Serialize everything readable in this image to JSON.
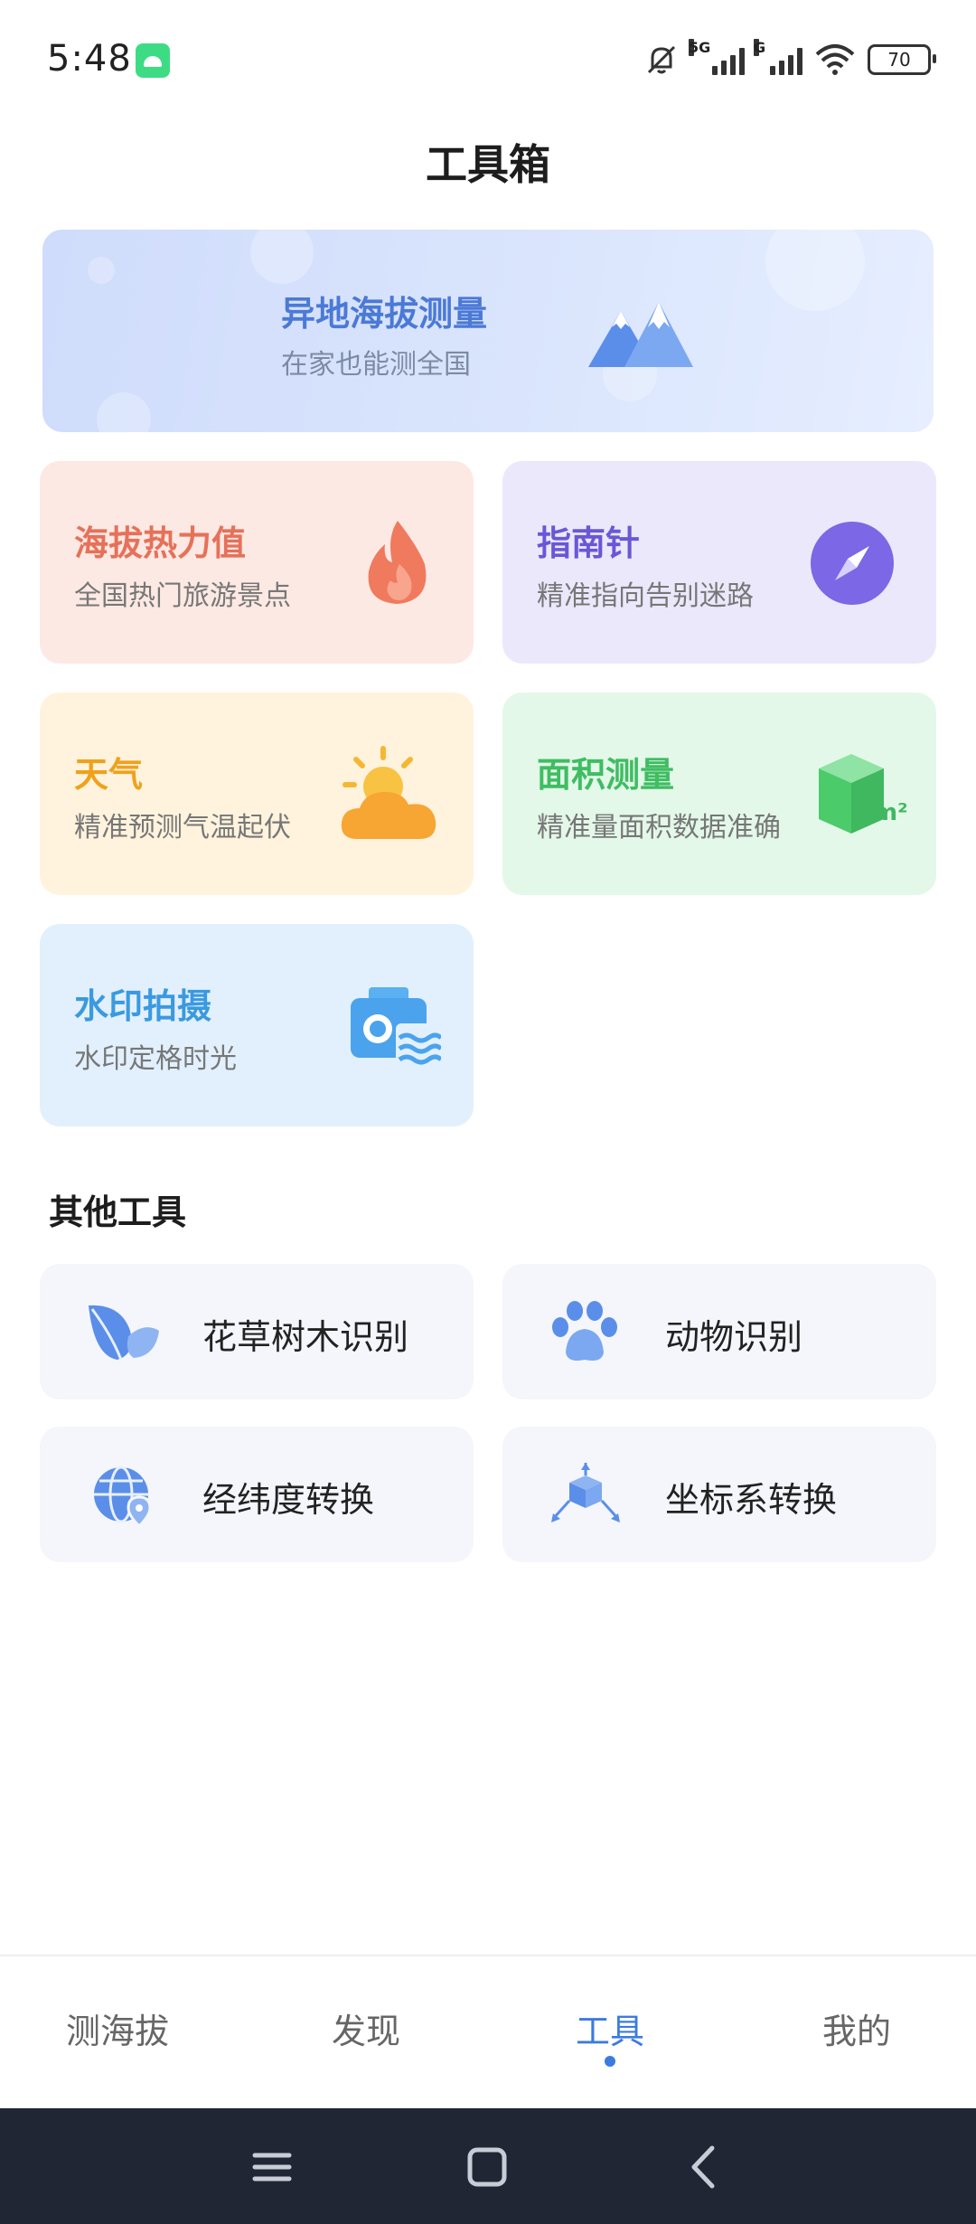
{
  "status_bar": {
    "time": "5:48",
    "network_1": "5G",
    "network_2": "G",
    "battery": "70",
    "icons": [
      "android-app-icon",
      "bell-off-icon",
      "signal-icon",
      "signal-icon",
      "wifi-icon",
      "battery-icon"
    ]
  },
  "page": {
    "title": "工具箱"
  },
  "featured": {
    "title": "异地海拔测量",
    "subtitle": "在家也能测全国",
    "icon": "mountain-icon"
  },
  "cards": [
    {
      "title": "海拔热力值",
      "subtitle": "全国热门旅游景点",
      "icon": "flame-icon",
      "color": "#e6715a"
    },
    {
      "title": "指南针",
      "subtitle": "精准指向告别迷路",
      "icon": "compass-icon",
      "color": "#6a57d6"
    },
    {
      "title": "天气",
      "subtitle": "精准预测气温起伏",
      "icon": "sun-cloud-icon",
      "color": "#f0a11b"
    },
    {
      "title": "面积测量",
      "subtitle": "精准量面积数据准确",
      "icon": "cube-area-icon",
      "color": "#3fbd62",
      "unit": "m²"
    },
    {
      "title": "水印拍摄",
      "subtitle": "水印定格时光",
      "icon": "watermark-camera-icon",
      "color": "#3a9ae0"
    }
  ],
  "other_tools": {
    "title": "其他工具",
    "items": [
      {
        "label": "花草树木识别",
        "icon": "leaf-icon"
      },
      {
        "label": "动物识别",
        "icon": "paw-icon"
      },
      {
        "label": "经纬度转换",
        "icon": "globe-pin-icon"
      },
      {
        "label": "坐标系转换",
        "icon": "coordinate-axes-icon"
      }
    ]
  },
  "tabbar": {
    "tabs": [
      {
        "label": "测海拔"
      },
      {
        "label": "发现"
      },
      {
        "label": "工具",
        "active": true
      },
      {
        "label": "我的"
      }
    ],
    "accent": "#3b7be0"
  },
  "navbar": {
    "icons": [
      "menu-icon",
      "home-icon",
      "back-icon"
    ]
  }
}
